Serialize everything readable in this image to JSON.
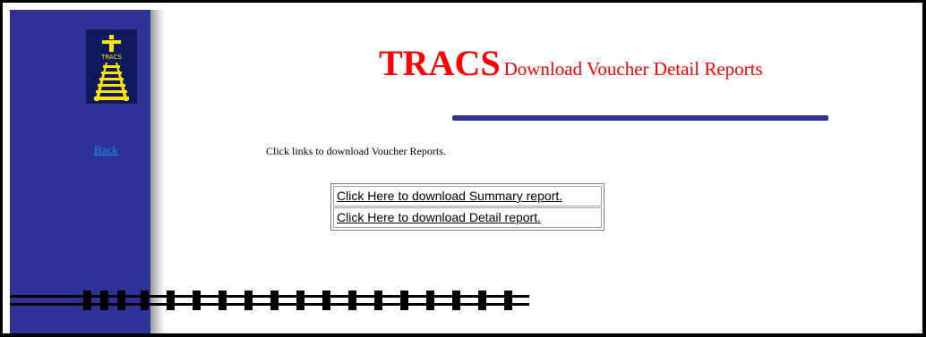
{
  "sidebar": {
    "logo_text": "TRACS",
    "back_label": "Back"
  },
  "header": {
    "title_main": "TRACS",
    "title_sub": "Download Voucher Detail Reports"
  },
  "main": {
    "instructions": "Click links to download Voucher Reports.",
    "links": [
      "Click Here to download Summary report.",
      "Click Here to download Detail report."
    ]
  },
  "colors": {
    "sidebar": "#2e3196",
    "title": "#ff0000",
    "link": "#1f8ff0",
    "logo_yellow": "#ffe500"
  }
}
